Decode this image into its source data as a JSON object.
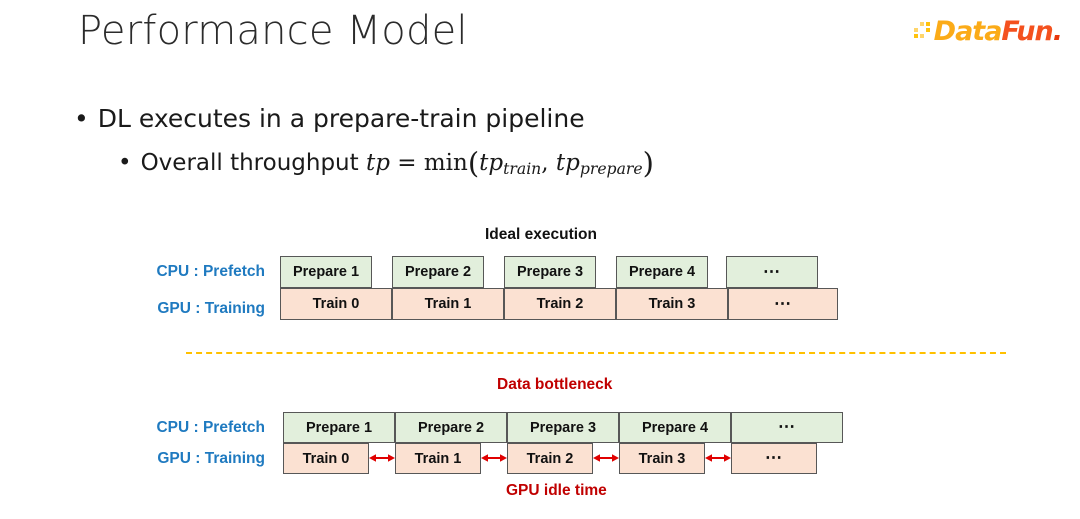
{
  "slide": {
    "title": "Performance Model"
  },
  "brand": {
    "name_part1": "Data",
    "name_part2": "Fun",
    "name_dot": ".",
    "colors": {
      "data": "#fbab18",
      "fun": "#f4511e",
      "dots": "#ffc20e"
    }
  },
  "bullets": {
    "marker": "•",
    "level1": "DL executes in a prepare-train pipeline",
    "level2_prefix": "Overall throughput ",
    "formula": {
      "lhs": "tp",
      "eq": "=",
      "fn": "min",
      "open": "(",
      "arg1_base": "tp",
      "arg1_sub": "train",
      "comma": ",",
      "arg2_base": "tp",
      "arg2_sub": "prepare",
      "close": ")",
      "plain": "tp = min(tp_train, tp_prepare)"
    }
  },
  "colors": {
    "prepare_fill": "#e2efdc",
    "train_fill": "#fbe1d2",
    "box_border": "#575757",
    "label_blue": "#1f7ac0",
    "accent_red": "#c00000",
    "divider_amber": "#ffc000"
  },
  "diagrams": [
    {
      "id": "ideal-execution",
      "caption": "Ideal execution",
      "caption_color": "#111111",
      "rows": [
        {
          "id": "cpu-prefetch",
          "label": "CPU : Prefetch",
          "cells": [
            "Prepare 1",
            "Prepare 2",
            "Prepare 3",
            "Prepare 4",
            "⋯"
          ]
        },
        {
          "id": "gpu-training",
          "label": "GPU : Training",
          "cells": [
            "Train 0",
            "Train 1",
            "Train 2",
            "Train 3",
            "⋯"
          ]
        }
      ],
      "note": null
    },
    {
      "id": "data-bottleneck",
      "caption": "Data bottleneck",
      "caption_color": "#c00000",
      "rows": [
        {
          "id": "cpu-prefetch",
          "label": "CPU : Prefetch",
          "cells": [
            "Prepare 1",
            "Prepare 2",
            "Prepare 3",
            "Prepare 4",
            "⋯"
          ]
        },
        {
          "id": "gpu-training",
          "label": "GPU : Training",
          "cells": [
            "Train 0",
            "Train 1",
            "Train 2",
            "Train 3",
            "⋯"
          ]
        }
      ],
      "note": "GPU idle time",
      "note_color": "#c00000",
      "idle_gaps": 4
    }
  ]
}
